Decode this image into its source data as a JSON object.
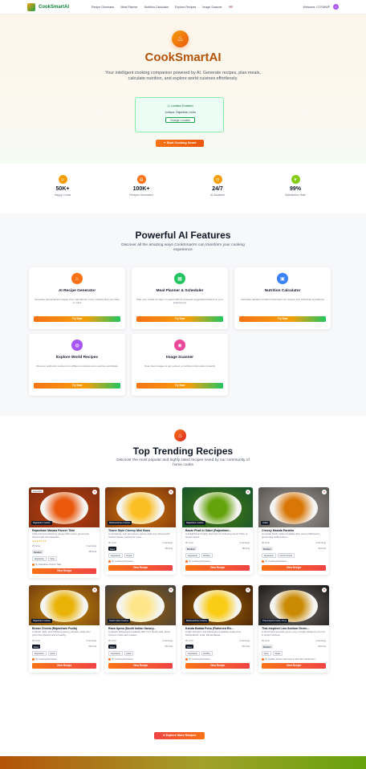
{
  "header": {
    "brand": "CookSmartAI",
    "nav": [
      "Recipe Generator",
      "Meal Planner",
      "Nutrition Calculator",
      "Explore Recipes",
      "Image Scanner"
    ],
    "welcome": "Welcome, COYMWP",
    "avatar_letter": "C"
  },
  "hero": {
    "title": "CookSmartAI",
    "subtitle": "Your intelligent cooking companion powered by AI. Generate recipes, plan meals, calculate nutrition, and explore world cuisines effortlessly.",
    "location_status": "Location Enabled",
    "location_value": "Jodhpur, Rajasthan, India",
    "change_location": "Change Location",
    "cta": "Start Cooking Smart"
  },
  "stats": [
    {
      "value": "50K+",
      "label": "Happy Cooks",
      "color": "#f59e0b"
    },
    {
      "value": "100K+",
      "label": "Recipes Generated",
      "color": "#f97316"
    },
    {
      "value": "24/7",
      "label": "AI Assistant",
      "color": "#f59e0b"
    },
    {
      "value": "99%",
      "label": "Satisfaction Rate",
      "color": "#84cc16"
    }
  ],
  "features": {
    "title": "Powerful AI Features",
    "subtitle": "Discover all the amazing ways CookSmartAI can transform your cooking experience",
    "cards": [
      {
        "title": "AI Recipe Generator",
        "desc": "Generate personalized recipes from ingredients in any cooking idea you have in mind",
        "button": "Try Now",
        "color": "#f97316"
      },
      {
        "title": "Meal Planner & Scheduler",
        "desc": "Plan your meals for days or weeks with AI powered suggestions based on your preferences",
        "button": "Try Now",
        "color": "#22c55e"
      },
      {
        "title": "Nutrition Calculator",
        "desc": "Calculate detailed nutrition information for recipes and individual ingredients",
        "button": "Try Now",
        "color": "#3b82f6"
      },
      {
        "title": "Explore World Recipes",
        "desc": "Discover authentic recipes from different cuisines and countries worldwide",
        "button": "Try Now",
        "color": "#a855f7"
      },
      {
        "title": "Image Scanner",
        "desc": "Scan food images to get recipes or nutrition information instantly",
        "button": "Try Now",
        "color": "#ec4899"
      }
    ]
  },
  "trending": {
    "title": "Top Trending Recipes",
    "subtitle": "Discover the most popular and highly-rated recipes loved by our community of home cooks",
    "explore_button": "Explore More Recipes",
    "recipes": [
      {
        "name": "Rajasthani Masala Paneer Tikki",
        "desc": "A flavorful and satisfying paneer tikki recipe, generously infused with rich Rajastha...",
        "cuisine": "Rajasthani Cuisine",
        "rating": "★★★★★ 4.8",
        "time": "25 mins",
        "servings": "4 servings",
        "difficulty": "Medium",
        "calories": "260 kcal",
        "tags": [
          "Vegetarian",
          "Spicy"
        ],
        "author": "By Rajasthani Kitchen Tales",
        "button": "View Recipe",
        "pill": "Vegetarian",
        "img": [
          "#7c2d12",
          "#c2410c"
        ],
        "plate": "#ea580c"
      },
      {
        "name": "Thane Style Cheesy Mini Buns",
        "desc": "A comforting, soft, and savory paneer-style bun infused with melted cheese, perfect for a tea...",
        "cuisine": "Maharashtrian Cuisine",
        "rating": "",
        "time": "30 mins",
        "servings": "6 servings",
        "difficulty": "Easy",
        "calories": "290 kcal",
        "tags": [
          "Vegetarian",
          "Snack"
        ],
        "author": "By Cooking Enthusiast",
        "button": "View Recipe",
        "pill": "",
        "img": [
          "#78350f",
          "#d97706"
        ],
        "plate": "#fbbf24"
      },
      {
        "name": "Bavar Phali ki Sabzi (Rajasthani...",
        "desc": "A delightful and highly flavourful dry featuring Guvar Phali, or cluster beans...",
        "cuisine": "Rajasthani Cuisine",
        "rating": "",
        "time": "35 mins",
        "servings": "4 servings",
        "difficulty": "Medium",
        "calories": "180 kcal",
        "tags": [
          "Vegetarian",
          "Healthy"
        ],
        "author": "By Cooking Enthusiast",
        "button": "View Recipe",
        "pill": "",
        "img": [
          "#14532d",
          "#4d7c0f"
        ],
        "plate": "#65a30d"
      },
      {
        "name": "Cheesy Masala Paratha",
        "desc": "A popular North Indian breakfast dish, savory flatbread is generously stuffed with a...",
        "cuisine": "Indian",
        "rating": "",
        "time": "25 mins",
        "servings": "4 servings",
        "difficulty": "Medium",
        "calories": "310 kcal",
        "tags": [
          "Vegetarian",
          "Comfort Food"
        ],
        "author": "By Cooking Enthusiast",
        "button": "View Recipe",
        "pill": "",
        "img": [
          "#57534e",
          "#a8a29e"
        ],
        "plate": "#d97706"
      },
      {
        "name": "Besan Cheela (Rajasthani Pudla)",
        "desc": "A classic, light, and nutritious savory pancake made from gram flour (besan) and a healthy...",
        "cuisine": "Rajasthani Cuisine",
        "rating": "",
        "time": "20 mins",
        "servings": "4 servings",
        "difficulty": "Easy",
        "calories": "200 kcal",
        "tags": [
          "Vegetarian",
          "Quick"
        ],
        "author": "By Cooking Enthusiast",
        "button": "View Recipe",
        "pill": "",
        "img": [
          "#713f12",
          "#ca8a04"
        ],
        "plate": "#eab308"
      },
      {
        "name": "Rava Upma (South Indian Savory...",
        "desc": "A classic, wholesome breakfast dish from South India. Rava Upma is made with roasted...",
        "cuisine": "South Indian Cuisine",
        "rating": "",
        "time": "20 mins",
        "servings": "4 servings",
        "difficulty": "Easy",
        "calories": "240 kcal",
        "tags": [
          "Vegetarian",
          "Quick"
        ],
        "author": "By Cooking Enthusiast",
        "button": "View Recipe",
        "pill": "",
        "img": [
          "#44403c",
          "#a16207"
        ],
        "plate": "#fde68a"
      },
      {
        "name": "Kanda Batata Poha (Flattened Ric...",
        "desc": "A light, flavorful, and wholesome breakfast staple from Maharashtra. India. Kanda Batata...",
        "cuisine": "Maharashtrian Cuisine",
        "rating": "",
        "time": "20 mins",
        "servings": "4 servings",
        "difficulty": "Easy",
        "calories": "220 kcal",
        "tags": [
          "Vegetarian",
          "Healthy"
        ],
        "author": "By Cooking Enthusiast",
        "button": "View Recipe",
        "pill": "",
        "img": [
          "#422006",
          "#a16207"
        ],
        "plate": "#facc15"
      },
      {
        "name": "Thai-Inspired Low-Sodium Green...",
        "desc": "A vibrant and aromatic green curry, lovingly adapted to be low in sodium without...",
        "cuisine": "Thai-Inspired Green Curry",
        "rating": "",
        "time": "35 mins",
        "servings": "4 servings",
        "difficulty": "Medium",
        "calories": "340 kcal",
        "tags": [
          "Spicy",
          "Vegan"
        ],
        "author": "By Healthy Kitchen Adventures (Chef Ben Sanderson)",
        "button": "View Recipe",
        "pill": "",
        "img": [
          "#1c1917",
          "#78716c"
        ],
        "plate": "#ca8a04"
      }
    ]
  }
}
